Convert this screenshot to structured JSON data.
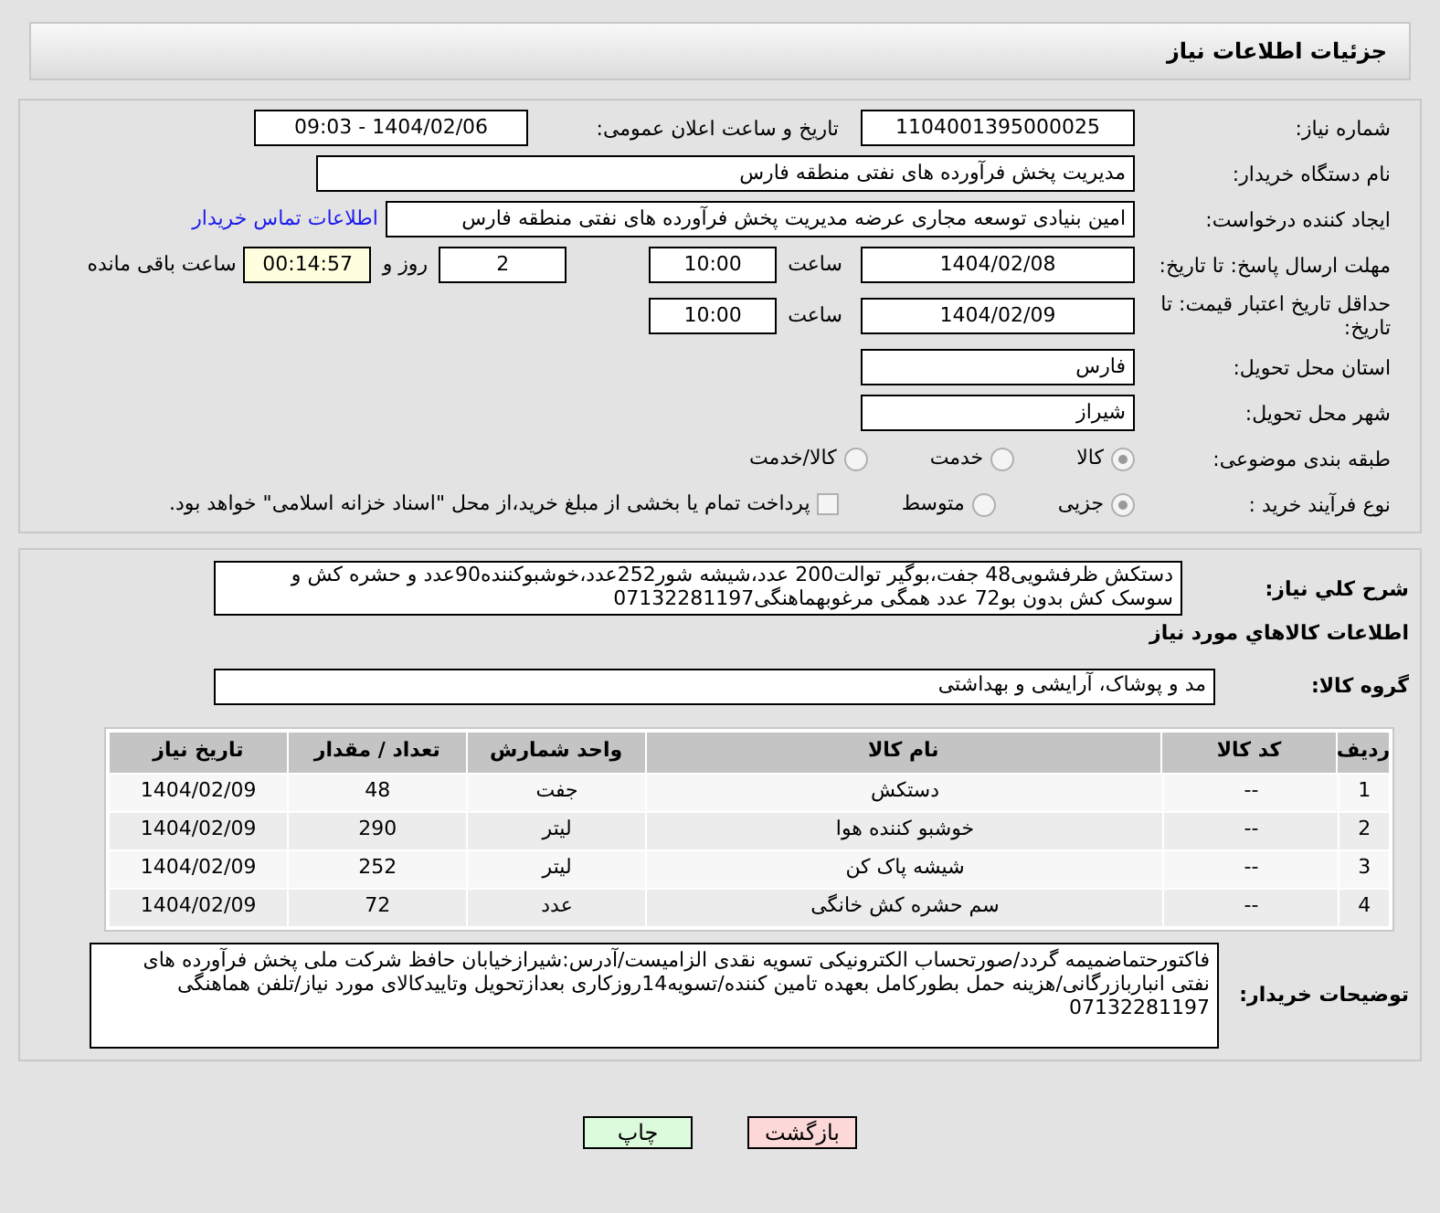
{
  "header": {
    "title": "جزئیات اطلاعات نیاز"
  },
  "need_number": {
    "label": "شماره نیاز:",
    "value": "1104001395000025"
  },
  "announce": {
    "label": "تاریخ و ساعت اعلان عمومی:",
    "value": "1404/02/06 - 09:03"
  },
  "buyer_org": {
    "label": "نام دستگاه خریدار:",
    "value": "مدیریت پخش فرآورده های نفتی منطقه فارس"
  },
  "requester": {
    "label": "ایجاد کننده درخواست:",
    "value": "امین بنیادی توسعه مجاری عرضه مدیریت پخش فرآورده های نفتی منطقه فارس",
    "link": "اطلاعات تماس خریدار"
  },
  "reply_deadline": {
    "label": "مهلت ارسال پاسخ: تا تاریخ:",
    "date": "1404/02/08",
    "time_label": "ساعت",
    "time": "10:00",
    "days": "2",
    "days_label": "روز و",
    "remaining": "00:14:57",
    "remaining_label": "ساعت باقی مانده"
  },
  "price_validity": {
    "label": "حداقل تاریخ اعتبار قیمت: تا تاریخ:",
    "date": "1404/02/09",
    "time_label": "ساعت",
    "time": "10:00"
  },
  "province": {
    "label": "استان محل تحویل:",
    "value": "فارس"
  },
  "city": {
    "label": "شهر محل تحویل:",
    "value": "شیراز"
  },
  "category": {
    "label": "طبقه بندی موضوعی:",
    "options": [
      {
        "label": "کالا",
        "selected": true
      },
      {
        "label": "خدمت",
        "selected": false
      },
      {
        "label": "کالا/خدمت",
        "selected": false
      }
    ]
  },
  "purchase_type": {
    "label": "نوع فرآیند خرید :",
    "options": [
      {
        "label": "جزیی",
        "selected": true
      },
      {
        "label": "متوسط",
        "selected": false
      }
    ],
    "treasury": {
      "checked": false,
      "text": "پرداخت تمام یا بخشی از مبلغ خرید،از محل \"اسناد خزانه اسلامی\" خواهد بود."
    }
  },
  "description": {
    "label": "شرح کلي نياز:",
    "value": "دستکش ظرفشویی48 جفت،بوگیر توالت200 عدد،شیشه شور252عدد،خوشبوکننده90عدد و حشره کش و سوسک کش بدون بو72 عدد همگی مرغوبهماهنگی07132281197"
  },
  "goods_heading": "اطلاعات کالاهاي مورد نياز",
  "goods_group": {
    "label": "گروه کالا:",
    "value": "مد و پوشاک، آرایشی و بهداشتی"
  },
  "table": {
    "columns": [
      "ردیف",
      "کد کالا",
      "نام کالا",
      "واحد شمارش",
      "تعداد / مقدار",
      "تاریخ نیاز"
    ],
    "rows": [
      [
        "1",
        "--",
        "دستکش",
        "جفت",
        "48",
        "1404/02/09"
      ],
      [
        "2",
        "--",
        "خوشبو کننده هوا",
        "لیتر",
        "290",
        "1404/02/09"
      ],
      [
        "3",
        "--",
        "شیشه پاک کن",
        "لیتر",
        "252",
        "1404/02/09"
      ],
      [
        "4",
        "--",
        "سم حشره کش خانگی",
        "عدد",
        "72",
        "1404/02/09"
      ]
    ]
  },
  "buyer_notes": {
    "label": "توضیحات خریدار:",
    "value": "فاکتورحتماضمیمه گردد/صورتحساب الکترونیکی تسویه نقدی الزامیست/آدرس:شیرازخیابان حافظ شرکت ملی پخش فرآورده های نفتی انباربازرگانی/هزینه حمل بطورکامل بعهده تامین کننده/تسویه14روزکاری بعدازتحویل وتاییدکالای مورد نیاز/تلفن هماهنگی 07132281197"
  },
  "buttons": [
    {
      "kind": "back",
      "label": "بازگشت"
    },
    {
      "kind": "print",
      "label": "چاپ"
    }
  ]
}
